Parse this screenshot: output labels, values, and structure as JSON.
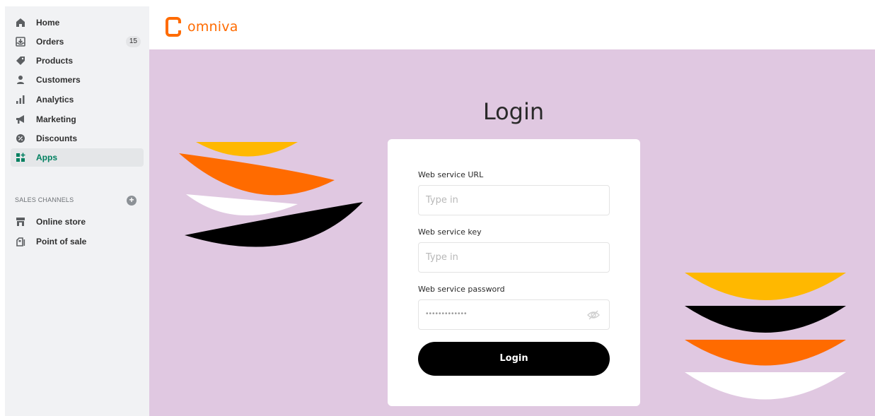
{
  "sidebar": {
    "items": [
      {
        "label": "Home",
        "icon": "home-icon"
      },
      {
        "label": "Orders",
        "icon": "orders-icon",
        "badge": "15"
      },
      {
        "label": "Products",
        "icon": "tag-icon"
      },
      {
        "label": "Customers",
        "icon": "person-icon"
      },
      {
        "label": "Analytics",
        "icon": "bar-chart-icon"
      },
      {
        "label": "Marketing",
        "icon": "megaphone-icon"
      },
      {
        "label": "Discounts",
        "icon": "discount-icon"
      },
      {
        "label": "Apps",
        "icon": "apps-icon",
        "active": true
      }
    ],
    "sales_channels_label": "SALES CHANNELS",
    "channels": [
      {
        "label": "Online store",
        "icon": "store-icon"
      },
      {
        "label": "Point of sale",
        "icon": "pos-icon"
      }
    ]
  },
  "header": {
    "logo_text": "omniva"
  },
  "login": {
    "title": "Login",
    "url_label": "Web service URL",
    "url_placeholder": "Type in",
    "key_label": "Web service key",
    "key_placeholder": "Type in",
    "password_label": "Web service password",
    "password_value": "•••••••••••••",
    "button_label": "Login"
  },
  "colors": {
    "accent": "#ff6b00",
    "background": "#e0c8e1",
    "yellow": "#ffb800",
    "black": "#000000",
    "white": "#ffffff"
  }
}
